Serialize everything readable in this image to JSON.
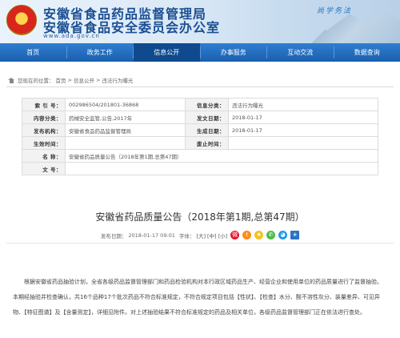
{
  "header": {
    "title_line1": "安徽省食品药品监督管理局",
    "title_line2": "安徽省食品安全委员会办公室",
    "url": "www.ada.gov.cn",
    "slogan": "尚学务法"
  },
  "nav": {
    "items": [
      {
        "label": "首页",
        "active": false
      },
      {
        "label": "政务工作",
        "active": false
      },
      {
        "label": "信息公开",
        "active": true
      },
      {
        "label": "办事服务",
        "active": false
      },
      {
        "label": "互动交流",
        "active": false
      },
      {
        "label": "数据查询",
        "active": false
      }
    ]
  },
  "breadcrumb": {
    "prefix": "您现在的位置：",
    "items": [
      "首页",
      "信息公开",
      "违法行为曝光"
    ],
    "separator": ">"
  },
  "meta": {
    "index_label": "索 引 号：",
    "index_value": "002986504/201801-36868",
    "category_label": "信息分类：",
    "category_value": "违法行为曝光",
    "content_label": "内容分类：",
    "content_value": "药械安全监管,公告,2017年",
    "doc_date_label": "发文日期：",
    "doc_date_value": "2018-01-17",
    "publisher_label": "发布机构：",
    "publisher_value": "安徽省食品药品监督管理局",
    "gen_date_label": "生成日期：",
    "gen_date_value": "2018-01-17",
    "effective_label": "生效时间：",
    "effective_value": "",
    "abolish_label": "废止时间：",
    "abolish_value": "",
    "name_label": "名    称：",
    "name_value": "安徽省药品质量公告（2018年第1期,总第47期）",
    "docno_label": "文    号：",
    "docno_value": ""
  },
  "article": {
    "title": "安徽省药品质量公告（2018年第1期,总第47期）",
    "pub_prefix": "发布日期：",
    "pub_date": "2018-01-17 09:01",
    "font_prefix": "字体：",
    "font_large": "[大]",
    "font_medium": "[中]",
    "font_small": "[小]",
    "share_icons": [
      "weibo-icon",
      "tencent-weibo-icon",
      "qzone-icon",
      "wechat-icon",
      "qq-icon",
      "more-share-icon"
    ],
    "body": "根据安徽省药品抽验计划，全省各级药品监督管理部门和药品检验机构对本行政区域药品生产、经营企业和使用单位的药品质量进行了监督抽验。本期经抽验并检查确认，共16个品种17个批次药品不符合标准规定，不符合规定项目包括【性状】、【检查】水分、酸不溶性灰分、装量差异、可见异物、【特征图谱】及【含量测定】，详细见附件。对上述抽验结果不符合标准规定的药品及相关单位，各级药品监督管理部门正在依法进行查处。"
  },
  "colors": {
    "nav_bg": "#1b5fae",
    "nav_active": "#0f4a8e",
    "title_color": "#1b4f93"
  }
}
